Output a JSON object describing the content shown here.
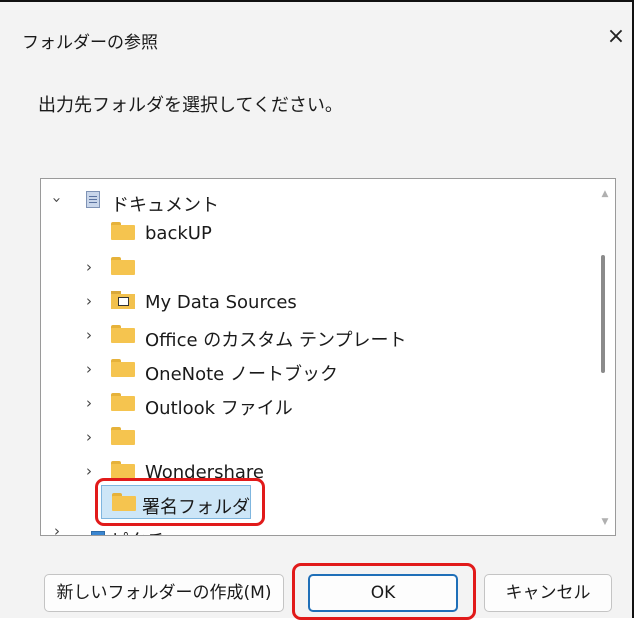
{
  "dialog": {
    "title": "フォルダーの参照",
    "close_glyph": "×",
    "message": "出力先フォルダを選択してください。"
  },
  "tree": {
    "items": [
      {
        "label": "ドキュメント",
        "expanded": true,
        "icon": "documents-icon"
      },
      {
        "label": "backUP",
        "icon": "folder-icon"
      },
      {
        "label": "",
        "icon": "folder-icon"
      },
      {
        "label": "My Data Sources",
        "icon": "data-sources-folder-icon"
      },
      {
        "label": "Office のカスタム テンプレート",
        "icon": "folder-icon"
      },
      {
        "label": "OneNote ノートブック",
        "icon": "folder-icon"
      },
      {
        "label": "Outlook ファイル",
        "icon": "folder-icon"
      },
      {
        "label": "",
        "icon": "folder-icon"
      },
      {
        "label": "Wondershare",
        "icon": "folder-icon"
      },
      {
        "label": "署名フォルダ",
        "icon": "folder-icon",
        "selected": true
      },
      {
        "label": "ピクチャ",
        "icon": "pictures-icon"
      }
    ],
    "expand_glyph": "›",
    "collapse_glyph": "⌄"
  },
  "buttons": {
    "new_folder": "新しいフォルダーの作成(M)",
    "ok": "OK",
    "cancel": "キャンセル"
  },
  "colors": {
    "highlight": "#e11a1a",
    "selection": "#cde6f7",
    "folder": "#f5c44f",
    "ok_border": "#1f6fb8"
  }
}
